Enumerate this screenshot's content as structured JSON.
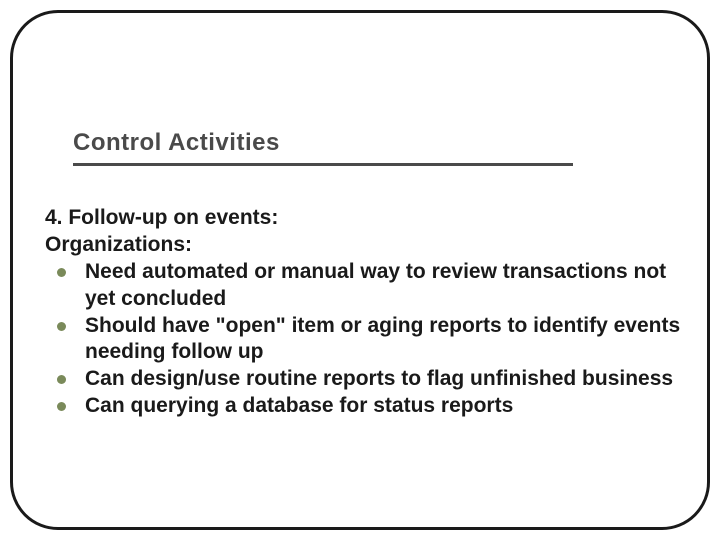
{
  "slide": {
    "title": "Control Activities",
    "heading": "4. Follow-up on events:",
    "subheading": "Organizations:",
    "bullets": [
      "Need automated or manual way to review transactions not yet concluded",
      "Should have \"open\" item or aging reports to identify events needing follow up",
      "Can design/use routine reports to flag unfinished business",
      "Can querying a database for status reports"
    ]
  }
}
